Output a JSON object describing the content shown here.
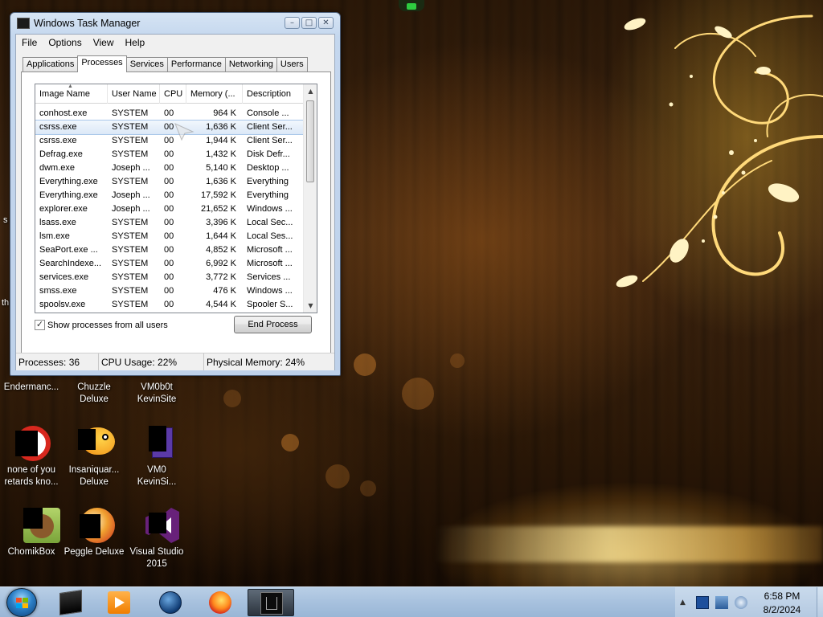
{
  "window": {
    "title": "Windows Task Manager",
    "controls": {
      "minimize": "–",
      "maximize": "□",
      "close": "✕"
    },
    "menu": [
      "File",
      "Options",
      "View",
      "Help"
    ],
    "tabs": [
      "Applications",
      "Processes",
      "Services",
      "Performance",
      "Networking",
      "Users"
    ],
    "active_tab": "Processes",
    "columns": [
      "Image Name",
      "User Name",
      "CPU",
      "Memory (...",
      "Description"
    ],
    "processes": [
      {
        "name": "conhost.exe",
        "user": "SYSTEM",
        "cpu": "00",
        "mem": "964 K",
        "desc": "Console ..."
      },
      {
        "name": "csrss.exe",
        "user": "SYSTEM",
        "cpu": "00",
        "mem": "1,636 K",
        "desc": "Client Ser..."
      },
      {
        "name": "csrss.exe",
        "user": "SYSTEM",
        "cpu": "00",
        "mem": "1,944 K",
        "desc": "Client Ser..."
      },
      {
        "name": "Defrag.exe",
        "user": "SYSTEM",
        "cpu": "00",
        "mem": "1,432 K",
        "desc": "Disk Defr..."
      },
      {
        "name": "dwm.exe",
        "user": "Joseph ...",
        "cpu": "00",
        "mem": "5,140 K",
        "desc": "Desktop ..."
      },
      {
        "name": "Everything.exe",
        "user": "SYSTEM",
        "cpu": "00",
        "mem": "1,636 K",
        "desc": "Everything"
      },
      {
        "name": "Everything.exe",
        "user": "Joseph ...",
        "cpu": "00",
        "mem": "17,592 K",
        "desc": "Everything"
      },
      {
        "name": "explorer.exe",
        "user": "Joseph ...",
        "cpu": "00",
        "mem": "21,652 K",
        "desc": "Windows ..."
      },
      {
        "name": "lsass.exe",
        "user": "SYSTEM",
        "cpu": "00",
        "mem": "3,396 K",
        "desc": "Local Sec..."
      },
      {
        "name": "lsm.exe",
        "user": "SYSTEM",
        "cpu": "00",
        "mem": "1,644 K",
        "desc": "Local Ses..."
      },
      {
        "name": "SeaPort.exe ...",
        "user": "SYSTEM",
        "cpu": "00",
        "mem": "4,852 K",
        "desc": "Microsoft ..."
      },
      {
        "name": "SearchIndexe...",
        "user": "SYSTEM",
        "cpu": "00",
        "mem": "6,992 K",
        "desc": "Microsoft ..."
      },
      {
        "name": "services.exe",
        "user": "SYSTEM",
        "cpu": "00",
        "mem": "3,772 K",
        "desc": "Services ..."
      },
      {
        "name": "smss.exe",
        "user": "SYSTEM",
        "cpu": "00",
        "mem": "476 K",
        "desc": "Windows ..."
      },
      {
        "name": "spoolsv.exe",
        "user": "SYSTEM",
        "cpu": "00",
        "mem": "4,544 K",
        "desc": "Spooler S..."
      }
    ],
    "selected_row": 1,
    "show_all_label": "Show processes from all users",
    "show_all_checked": true,
    "checkmark": "✓",
    "end_process_label": "End Process",
    "status": {
      "processes": "Processes: 36",
      "cpu": "CPU Usage: 22%",
      "memory": "Physical Memory: 24%"
    }
  },
  "desktop": {
    "edge_text": [
      "s",
      "th"
    ],
    "icons": [
      {
        "label": "Endermanc..."
      },
      {
        "label": "Chuzzle\nDeluxe"
      },
      {
        "label": "VM0b0t\nKevinSite"
      },
      {
        "label": "none of you\nretards kno..."
      },
      {
        "label": "Insaniquar...\nDeluxe"
      },
      {
        "label": "VM0\nKevinSi..."
      },
      {
        "label": "ChomikBox"
      },
      {
        "label": "Peggle Deluxe"
      },
      {
        "label": "Visual Studio\n2015"
      }
    ]
  },
  "taskbar": {
    "icons": [
      "start-orb",
      "terminal",
      "media-player",
      "browser-globe",
      "firefox",
      "task-manager"
    ],
    "clock_time": "6:58 PM",
    "clock_date": "8/2/2024"
  }
}
